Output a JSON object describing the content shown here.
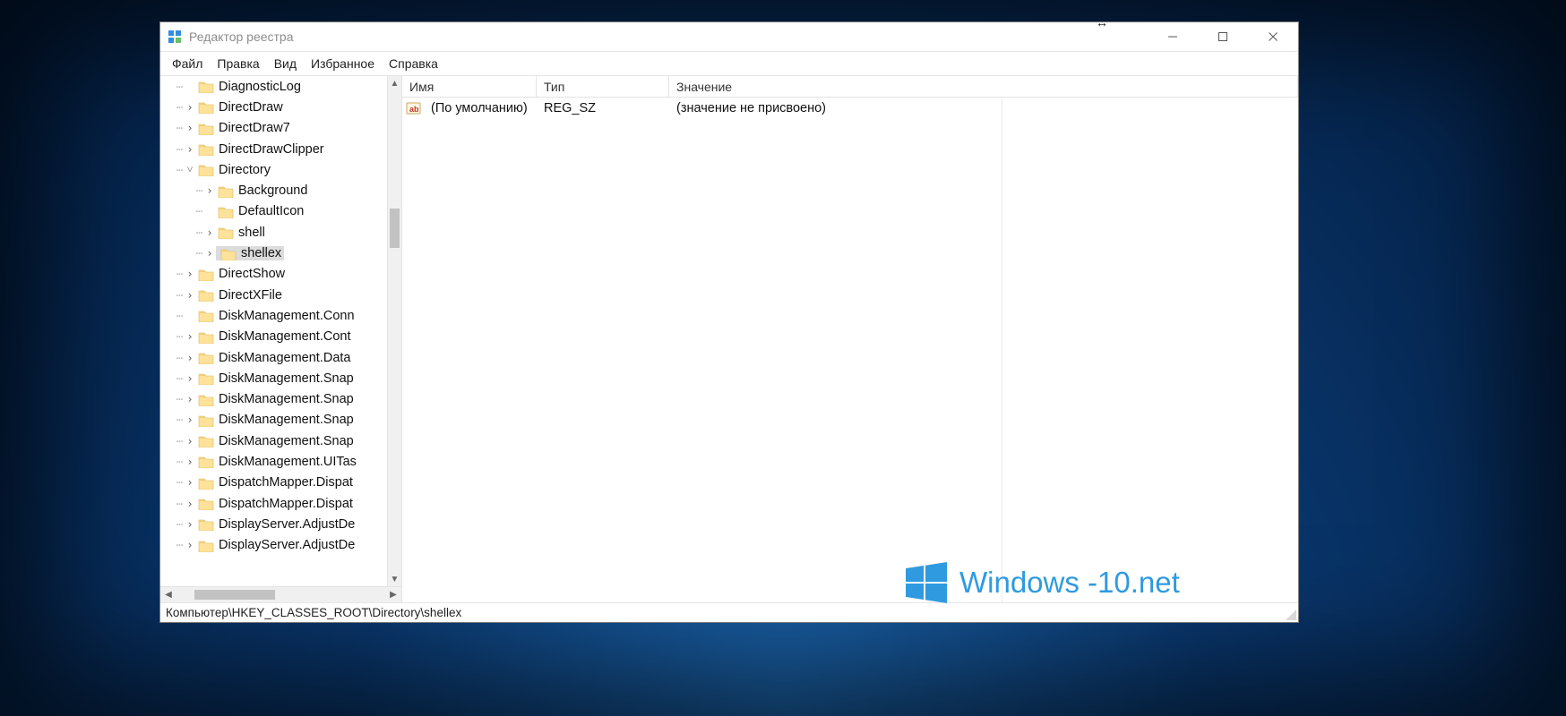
{
  "titlebar": {
    "title": "Редактор реестра"
  },
  "menubar": {
    "items": [
      "Файл",
      "Правка",
      "Вид",
      "Избранное",
      "Справка"
    ]
  },
  "tree": {
    "items": [
      {
        "indent": 1,
        "twisty": "",
        "label": "DiagnosticLog",
        "expandable": false
      },
      {
        "indent": 1,
        "twisty": ">",
        "label": "DirectDraw",
        "expandable": true
      },
      {
        "indent": 1,
        "twisty": ">",
        "label": "DirectDraw7",
        "expandable": true
      },
      {
        "indent": 1,
        "twisty": ">",
        "label": "DirectDrawClipper",
        "expandable": true
      },
      {
        "indent": 1,
        "twisty": "v",
        "label": "Directory",
        "expandable": true
      },
      {
        "indent": 2,
        "twisty": ">",
        "label": "Background",
        "expandable": true
      },
      {
        "indent": 2,
        "twisty": "",
        "label": "DefaultIcon",
        "expandable": false
      },
      {
        "indent": 2,
        "twisty": ">",
        "label": "shell",
        "expandable": true
      },
      {
        "indent": 2,
        "twisty": ">",
        "label": "shellex",
        "expandable": true,
        "selected": true
      },
      {
        "indent": 1,
        "twisty": ">",
        "label": "DirectShow",
        "expandable": true
      },
      {
        "indent": 1,
        "twisty": ">",
        "label": "DirectXFile",
        "expandable": true
      },
      {
        "indent": 1,
        "twisty": "",
        "label": "DiskManagement.Conn",
        "expandable": false
      },
      {
        "indent": 1,
        "twisty": ">",
        "label": "DiskManagement.Cont",
        "expandable": true
      },
      {
        "indent": 1,
        "twisty": ">",
        "label": "DiskManagement.Data",
        "expandable": true
      },
      {
        "indent": 1,
        "twisty": ">",
        "label": "DiskManagement.Snap",
        "expandable": true
      },
      {
        "indent": 1,
        "twisty": ">",
        "label": "DiskManagement.Snap",
        "expandable": true
      },
      {
        "indent": 1,
        "twisty": ">",
        "label": "DiskManagement.Snap",
        "expandable": true
      },
      {
        "indent": 1,
        "twisty": ">",
        "label": "DiskManagement.Snap",
        "expandable": true
      },
      {
        "indent": 1,
        "twisty": ">",
        "label": "DiskManagement.UITas",
        "expandable": true
      },
      {
        "indent": 1,
        "twisty": ">",
        "label": "DispatchMapper.Dispat",
        "expandable": true
      },
      {
        "indent": 1,
        "twisty": ">",
        "label": "DispatchMapper.Dispat",
        "expandable": true
      },
      {
        "indent": 1,
        "twisty": ">",
        "label": "DisplayServer.AdjustDe",
        "expandable": true
      },
      {
        "indent": 1,
        "twisty": ">",
        "label": "DisplayServer.AdjustDe",
        "expandable": true
      }
    ]
  },
  "columns": {
    "name": "Имя",
    "type": "Тип",
    "value": "Значение"
  },
  "rows": [
    {
      "name": "(По умолчанию)",
      "type": "REG_SZ",
      "value": "(значение не присвоено)"
    }
  ],
  "statusbar": {
    "path": "Компьютер\\HKEY_CLASSES_ROOT\\Directory\\shellex"
  },
  "watermark": {
    "text": "Windows -10.net"
  }
}
